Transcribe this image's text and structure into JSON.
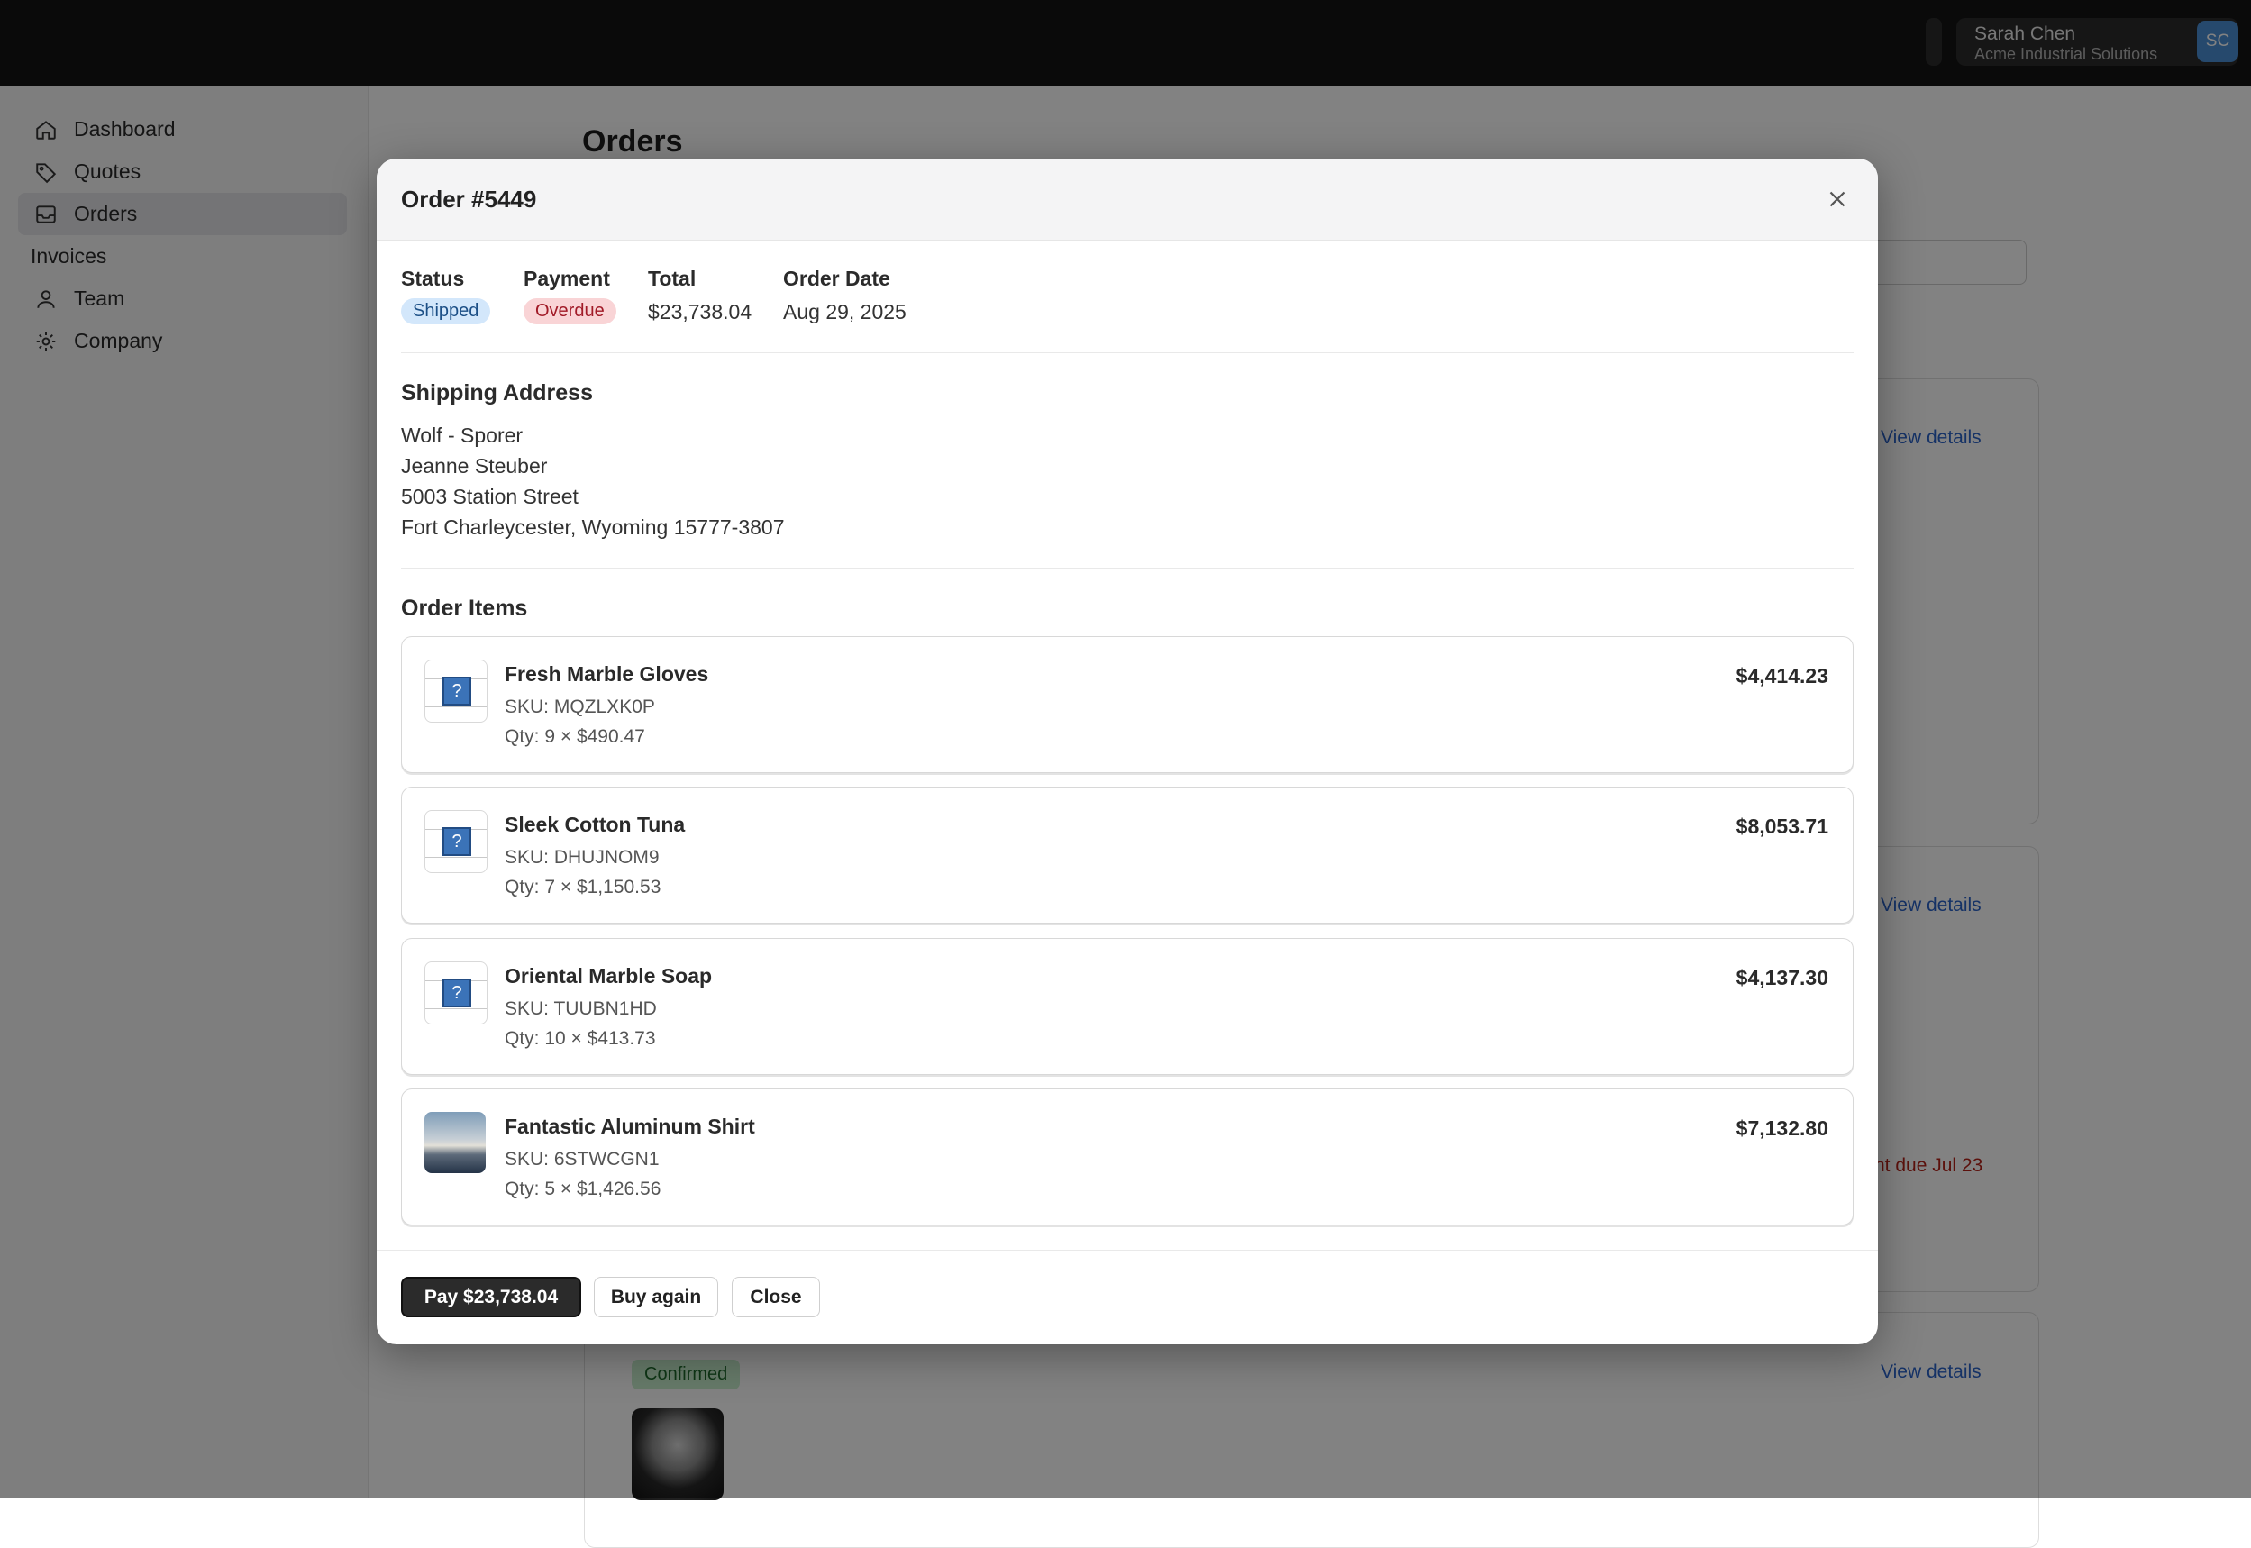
{
  "header": {
    "user_name": "Sarah Chen",
    "user_org": "Acme Industrial Solutions",
    "user_initials": "SC"
  },
  "sidebar": {
    "items": [
      {
        "label": "Dashboard",
        "icon": "home-icon"
      },
      {
        "label": "Quotes",
        "icon": "tag-icon"
      },
      {
        "label": "Orders",
        "icon": "inbox-icon",
        "active": true
      },
      {
        "label": "Invoices",
        "icon": null
      },
      {
        "label": "Team",
        "icon": "user-icon"
      },
      {
        "label": "Company",
        "icon": "gear-icon"
      }
    ]
  },
  "main": {
    "title": "Orders",
    "view_details_label": "View details",
    "due_text": "nt due Jul 23",
    "confirmed_badge": "Confirmed"
  },
  "modal": {
    "title": "Order #5449",
    "status_label": "Status",
    "status_value": "Shipped",
    "payment_label": "Payment",
    "payment_value": "Overdue",
    "total_label": "Total",
    "total_value": "$23,738.04",
    "date_label": "Order Date",
    "date_value": "Aug 29, 2025",
    "shipping_title": "Shipping Address",
    "address": [
      "Wolf - Sporer",
      "Jeanne Steuber",
      "5003 Station Street",
      "Fort Charleycester, Wyoming 15777-3807"
    ],
    "items_title": "Order Items",
    "items": [
      {
        "name": "Fresh Marble Gloves",
        "sku": "SKU: MQZLXK0P",
        "qty": "Qty: 9 × $490.47",
        "price": "$4,414.23",
        "image": "placeholder"
      },
      {
        "name": "Sleek Cotton Tuna",
        "sku": "SKU: DHUJNOM9",
        "qty": "Qty: 7 × $1,150.53",
        "price": "$8,053.71",
        "image": "placeholder"
      },
      {
        "name": "Oriental Marble Soap",
        "sku": "SKU: TUUBN1HD",
        "qty": "Qty: 10 × $413.73",
        "price": "$4,137.30",
        "image": "placeholder"
      },
      {
        "name": "Fantastic Aluminum Shirt",
        "sku": "SKU: 6STWCGN1",
        "qty": "Qty: 5 × $1,426.56",
        "price": "$7,132.80",
        "image": "photo"
      }
    ],
    "pay_button": "Pay $23,738.04",
    "buy_again_button": "Buy again",
    "close_button": "Close"
  },
  "colors": {
    "status_shipped_bg": "#d3e7fb",
    "payment_overdue_bg": "#f9d4d6",
    "link": "#2a62c9",
    "primary_button": "#2b2b2b"
  }
}
